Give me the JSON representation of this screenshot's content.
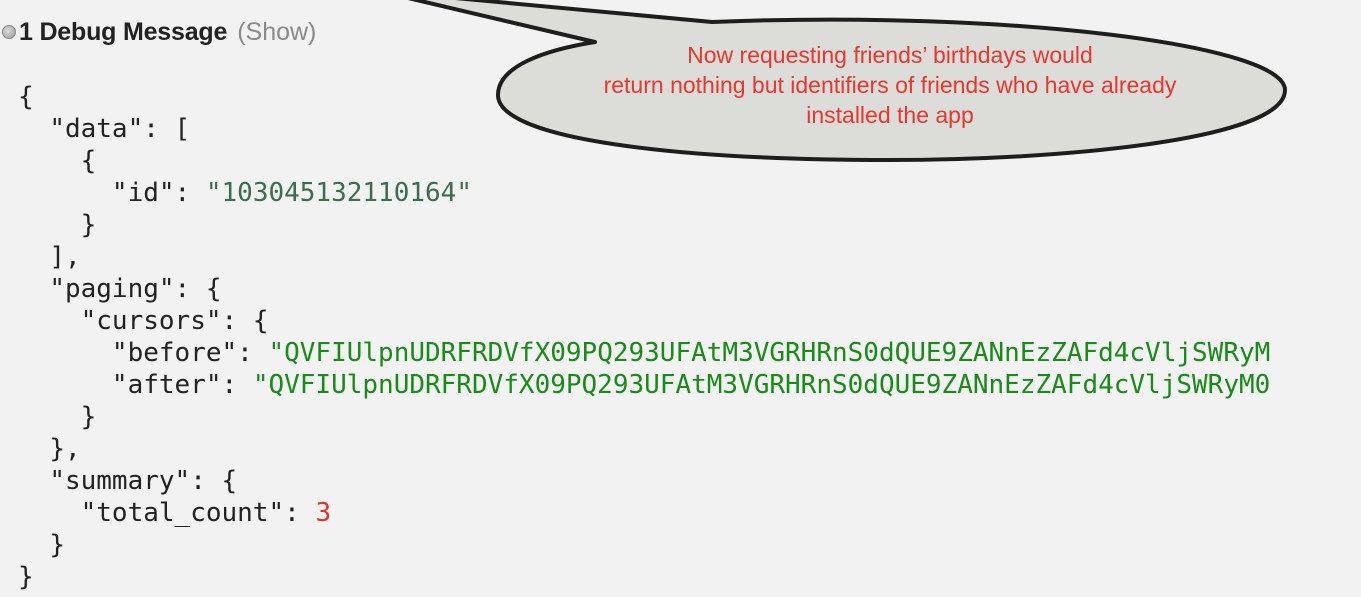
{
  "header": {
    "title": "1 Debug Message",
    "show_label": "(Show)"
  },
  "json_lines": {
    "l1": "{",
    "l2_key": "\"data\"",
    "l2_rest": ": [",
    "l3": "{",
    "l4_key": "\"id\"",
    "l4_sep": ": ",
    "l4_val": "\"103045132110164\"",
    "l5": "}",
    "l6": "],",
    "l7_key": "\"paging\"",
    "l7_rest": ": {",
    "l8_key": "\"cursors\"",
    "l8_rest": ": {",
    "l9_key": "\"before\"",
    "l9_sep": ": ",
    "l9_val": "\"QVFIUlpnUDRFRDVfX09PQ293UFAtM3VGRHRnS0dQUE9ZANnEzZAFd4cVljSWRyM",
    "l10_key": "\"after\"",
    "l10_sep": ": ",
    "l10_val": "\"QVFIUlpnUDRFRDVfX09PQ293UFAtM3VGRHRnS0dQUE9ZANnEzZAFd4cVljSWRyM0",
    "l11": "}",
    "l12": "},",
    "l13_key": "\"summary\"",
    "l13_rest": ": {",
    "l14_key": "\"total_count\"",
    "l14_sep": ": ",
    "l14_val": "3",
    "l15": "}",
    "l16": "}"
  },
  "callout": {
    "line1": "Now requesting friends’ birthdays would",
    "line2": "return nothing but identifiers of friends who have already",
    "line3": "installed the app"
  },
  "colors": {
    "string": "#1a8a1a",
    "number": "#e0342a",
    "callout_text": "#e8372e",
    "callout_fill": "#dcdcd8"
  }
}
